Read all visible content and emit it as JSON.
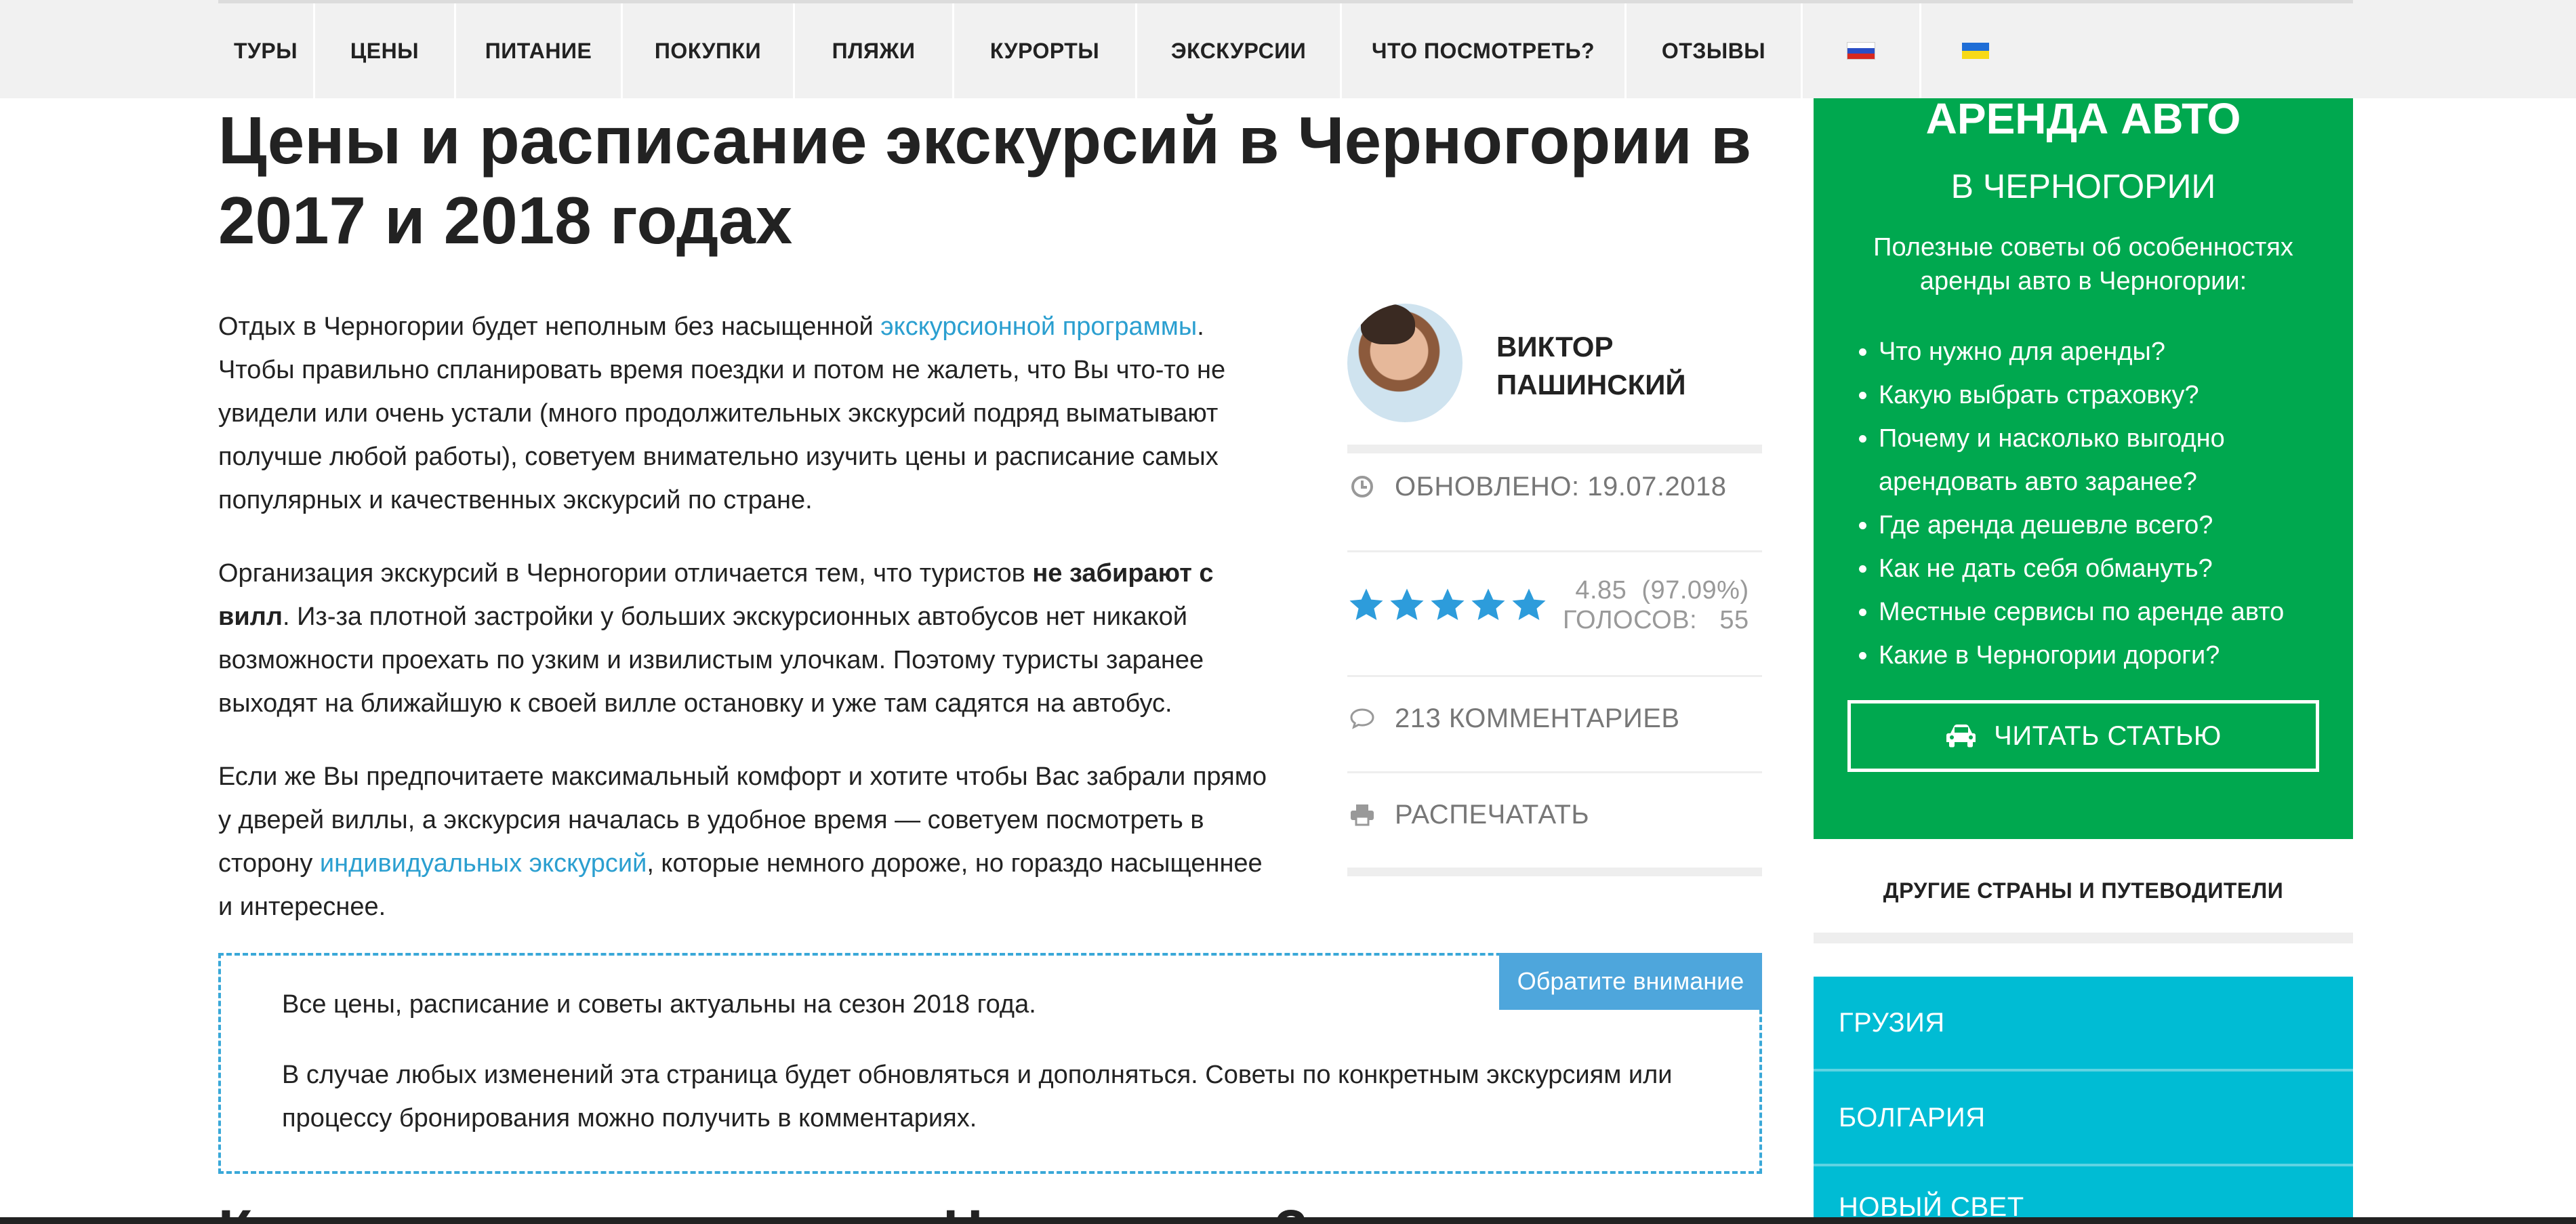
{
  "nav": {
    "items": [
      "ТУРЫ",
      "ЦЕНЫ",
      "ПИТАНИЕ",
      "ПОКУПКИ",
      "ПЛЯЖИ",
      "КУРОРТЫ",
      "ЭКСКУРСИИ",
      "ЧТО ПОСМОТРЕТЬ?",
      "ОТЗЫВЫ"
    ],
    "flags": [
      "flag-ru-icon",
      "flag-ua-icon"
    ]
  },
  "article": {
    "title": "Цены и расписание экскурсий в Черногории в 2017 и 2018 годах",
    "p1_a": "Отдых в Черногории будет неполным без насыщенной ",
    "p1_link": "экскурсионной программы",
    "p1_b": ". Чтобы правильно спланировать время поездки и потом не жалеть, что Вы что-то не увидели или очень устали (много продолжительных экскурсий подряд выматывают получше любой работы), советуем внимательно изучить цены и расписание самых популярных и качественных экскурсий по стране.",
    "p2_a": "Организация экскурсий в Черногории отличается тем, что туристов ",
    "p2_bold": "не забирают с вилл",
    "p2_b": ". Из-за плотной застройки у больших экскурсионных автобусов нет никакой возможности проехать по узким и извилистым улочкам. Поэтому туристы заранее выходят на ближайшую к своей вилле остановку и уже там садятся на автобус.",
    "p3_a": "Если же Вы предпочитаете максимальный комфорт и хотите чтобы Вас забрали прямо у дверей виллы, а экскурсия началась в удобное время — советуем посмотреть в сторону ",
    "p3_link": "индивидуальных экскурсий",
    "p3_b": ", которые немного дороже, но гораздо насыщеннее и интереснее.",
    "next_heading": "Как оплатить экскурсии в Черногории?"
  },
  "author": {
    "name_line1": "ВИКТОР",
    "name_line2": "ПАШИНСКИЙ",
    "updated": "ОБНОВЛЕНО: 19.07.2018",
    "rating": "4.85",
    "rating_pct": "(97.09%)",
    "votes_label": "ГОЛОСОВ:",
    "votes": "55",
    "stars_filled": 5,
    "comments": "213 КОММЕНТАРИЕВ",
    "print": "РАСПЕЧАТАТЬ"
  },
  "notice": {
    "tag": "Обратите внимание",
    "line1": "Все цены, расписание и советы актуальны на сезон 2018 года.",
    "line2": "В случае любых изменений эта страница будет обновляться и дополняться. Советы по конкретным экскурсиям или процессу бронирования можно получить в комментариях."
  },
  "promo": {
    "title": "АРЕНДА АВТО",
    "subtitle": "В ЧЕРНОГОРИИ",
    "desc": "Полезные советы об особенностях аренды авто в Черногории:",
    "items": [
      "Что нужно для аренды?",
      "Какую выбрать страховку?",
      "Почему и насколько выгодно арендовать авто заранее?",
      "Где аренда дешевле всего?",
      "Как не дать себя обмануть?",
      "Местные сервисы по аренде авто",
      "Какие в Черногории дороги?"
    ],
    "button": "ЧИТАТЬ СТАТЬЮ",
    "color": "#00a84f"
  },
  "sidebar": {
    "other_title": "ДРУГИЕ СТРАНЫ И ПУТЕВОДИТЕЛИ",
    "countries": [
      "ГРУЗИЯ",
      "БОЛГАРИЯ",
      "НОВЫЙ СВЕТ"
    ],
    "color": "#00bcd4"
  }
}
